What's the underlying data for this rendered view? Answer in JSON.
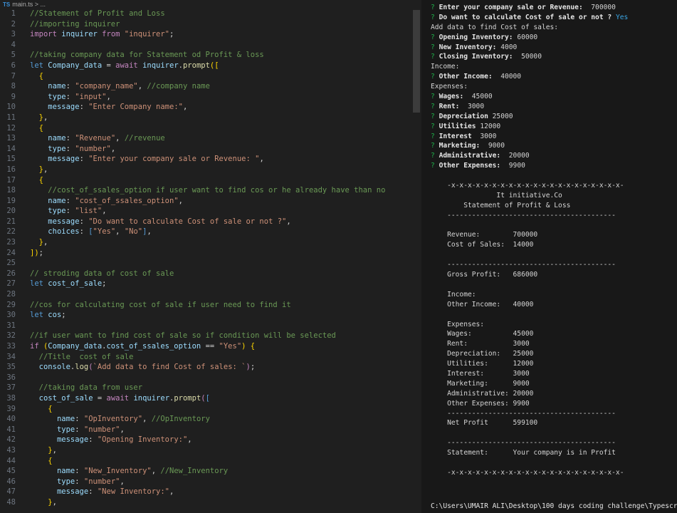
{
  "breadcrumb": {
    "badge": "TS",
    "file": "main.ts",
    "sep": " > ..."
  },
  "code_lines": [
    [
      [
        "c",
        "//Statement of Profit and Loss"
      ]
    ],
    [
      [
        "c",
        "//importing inquirer"
      ]
    ],
    [
      [
        "k",
        "import "
      ],
      [
        "v",
        "inquirer "
      ],
      [
        "k",
        "from "
      ],
      [
        "s",
        "\"inquirer\""
      ],
      [
        "p",
        ";"
      ]
    ],
    [
      [
        "p",
        ""
      ]
    ],
    [
      [
        "c",
        "//taking company data for Statement od Profit & loss"
      ]
    ],
    [
      [
        "b",
        "let "
      ],
      [
        "v",
        "Company_data "
      ],
      [
        "p",
        "= "
      ],
      [
        "k",
        "await "
      ],
      [
        "v",
        "inquirer"
      ],
      [
        "p",
        "."
      ],
      [
        "f",
        "prompt"
      ],
      [
        "y",
        "(["
      ]
    ],
    [
      [
        "p",
        "  "
      ],
      [
        "y",
        "{"
      ]
    ],
    [
      [
        "p",
        "    "
      ],
      [
        "v",
        "name"
      ],
      [
        "p",
        ": "
      ],
      [
        "s",
        "\"company_name\""
      ],
      [
        "p",
        ", "
      ],
      [
        "c",
        "//company name"
      ]
    ],
    [
      [
        "p",
        "    "
      ],
      [
        "v",
        "type"
      ],
      [
        "p",
        ": "
      ],
      [
        "s",
        "\"input\""
      ],
      [
        "p",
        ","
      ]
    ],
    [
      [
        "p",
        "    "
      ],
      [
        "v",
        "message"
      ],
      [
        "p",
        ": "
      ],
      [
        "s",
        "\"Enter Company name:\""
      ],
      [
        "p",
        ","
      ]
    ],
    [
      [
        "p",
        "  "
      ],
      [
        "y",
        "}"
      ],
      [
        "p",
        ","
      ]
    ],
    [
      [
        "p",
        "  "
      ],
      [
        "y",
        "{"
      ]
    ],
    [
      [
        "p",
        "    "
      ],
      [
        "v",
        "name"
      ],
      [
        "p",
        ": "
      ],
      [
        "s",
        "\"Revenue\""
      ],
      [
        "p",
        ", "
      ],
      [
        "c",
        "//revenue"
      ]
    ],
    [
      [
        "p",
        "    "
      ],
      [
        "v",
        "type"
      ],
      [
        "p",
        ": "
      ],
      [
        "s",
        "\"number\""
      ],
      [
        "p",
        ","
      ]
    ],
    [
      [
        "p",
        "    "
      ],
      [
        "v",
        "message"
      ],
      [
        "p",
        ": "
      ],
      [
        "s",
        "\"Enter your company sale or Revenue: \""
      ],
      [
        "p",
        ","
      ]
    ],
    [
      [
        "p",
        "  "
      ],
      [
        "y",
        "}"
      ],
      [
        "p",
        ","
      ]
    ],
    [
      [
        "p",
        "  "
      ],
      [
        "y",
        "{"
      ]
    ],
    [
      [
        "p",
        "    "
      ],
      [
        "c",
        "//cost_of_ssales_option if user want to find cos or he already have than no"
      ]
    ],
    [
      [
        "p",
        "    "
      ],
      [
        "v",
        "name"
      ],
      [
        "p",
        ": "
      ],
      [
        "s",
        "\"cost_of_ssales_option\""
      ],
      [
        "p",
        ","
      ]
    ],
    [
      [
        "p",
        "    "
      ],
      [
        "v",
        "type"
      ],
      [
        "p",
        ": "
      ],
      [
        "s",
        "\"list\""
      ],
      [
        "p",
        ","
      ]
    ],
    [
      [
        "p",
        "    "
      ],
      [
        "v",
        "message"
      ],
      [
        "p",
        ": "
      ],
      [
        "s",
        "\"Do want to calculate Cost of sale or not ?\""
      ],
      [
        "p",
        ","
      ]
    ],
    [
      [
        "p",
        "    "
      ],
      [
        "v",
        "choices"
      ],
      [
        "p",
        ": "
      ],
      [
        "b",
        "["
      ],
      [
        "s",
        "\"Yes\""
      ],
      [
        "p",
        ", "
      ],
      [
        "s",
        "\"No\""
      ],
      [
        "b",
        "]"
      ],
      [
        "p",
        ","
      ]
    ],
    [
      [
        "p",
        "  "
      ],
      [
        "y",
        "}"
      ],
      [
        "p",
        ","
      ]
    ],
    [
      [
        "y",
        "])"
      ],
      [
        "p",
        ";"
      ]
    ],
    [
      [
        "p",
        ""
      ]
    ],
    [
      [
        "c",
        "// stroding data of cost of sale"
      ]
    ],
    [
      [
        "b",
        "let "
      ],
      [
        "v",
        "cost_of_sale"
      ],
      [
        "p",
        ";"
      ]
    ],
    [
      [
        "p",
        ""
      ]
    ],
    [
      [
        "c",
        "//cos for calculating cost of sale if user need to find it"
      ]
    ],
    [
      [
        "b",
        "let "
      ],
      [
        "v",
        "cos"
      ],
      [
        "p",
        ";"
      ]
    ],
    [
      [
        "p",
        ""
      ]
    ],
    [
      [
        "c",
        "//if user want to find cost of sale so if condition will be selected"
      ]
    ],
    [
      [
        "k",
        "if "
      ],
      [
        "y",
        "("
      ],
      [
        "v",
        "Company_data"
      ],
      [
        "p",
        "."
      ],
      [
        "v",
        "cost_of_ssales_option "
      ],
      [
        "p",
        "== "
      ],
      [
        "s",
        "\"Yes\""
      ],
      [
        "y",
        ") "
      ],
      [
        "y",
        "{"
      ]
    ],
    [
      [
        "p",
        "  "
      ],
      [
        "c",
        "//Title  cost of sale"
      ]
    ],
    [
      [
        "p",
        "  "
      ],
      [
        "v",
        "console"
      ],
      [
        "p",
        "."
      ],
      [
        "f",
        "log"
      ],
      [
        "k",
        "("
      ],
      [
        "s",
        "`Add data to find Cost of sales: `"
      ],
      [
        "k",
        ")"
      ],
      [
        "p",
        ";"
      ]
    ],
    [
      [
        "p",
        ""
      ]
    ],
    [
      [
        "p",
        "  "
      ],
      [
        "c",
        "//taking data from user"
      ]
    ],
    [
      [
        "p",
        "  "
      ],
      [
        "v",
        "cost_of_sale "
      ],
      [
        "p",
        "= "
      ],
      [
        "k",
        "await "
      ],
      [
        "v",
        "inquirer"
      ],
      [
        "p",
        "."
      ],
      [
        "f",
        "prompt"
      ],
      [
        "k",
        "("
      ],
      [
        "b",
        "["
      ]
    ],
    [
      [
        "p",
        "    "
      ],
      [
        "y",
        "{"
      ]
    ],
    [
      [
        "p",
        "      "
      ],
      [
        "v",
        "name"
      ],
      [
        "p",
        ": "
      ],
      [
        "s",
        "\"OpInventory\""
      ],
      [
        "p",
        ", "
      ],
      [
        "c",
        "//OpInventory"
      ]
    ],
    [
      [
        "p",
        "      "
      ],
      [
        "v",
        "type"
      ],
      [
        "p",
        ": "
      ],
      [
        "s",
        "\"number\""
      ],
      [
        "p",
        ","
      ]
    ],
    [
      [
        "p",
        "      "
      ],
      [
        "v",
        "message"
      ],
      [
        "p",
        ": "
      ],
      [
        "s",
        "\"Opening Inventory:\""
      ],
      [
        "p",
        ","
      ]
    ],
    [
      [
        "p",
        "    "
      ],
      [
        "y",
        "}"
      ],
      [
        "p",
        ","
      ]
    ],
    [
      [
        "p",
        "    "
      ],
      [
        "y",
        "{"
      ]
    ],
    [
      [
        "p",
        "      "
      ],
      [
        "v",
        "name"
      ],
      [
        "p",
        ": "
      ],
      [
        "s",
        "\"New_Inventory\""
      ],
      [
        "p",
        ", "
      ],
      [
        "c",
        "//New_Inventory"
      ]
    ],
    [
      [
        "p",
        "      "
      ],
      [
        "v",
        "type"
      ],
      [
        "p",
        ": "
      ],
      [
        "s",
        "\"number\""
      ],
      [
        "p",
        ","
      ]
    ],
    [
      [
        "p",
        "      "
      ],
      [
        "v",
        "message"
      ],
      [
        "p",
        ": "
      ],
      [
        "s",
        "\"New Inventory:\""
      ],
      [
        "p",
        ","
      ]
    ],
    [
      [
        "p",
        "    "
      ],
      [
        "y",
        "}"
      ],
      [
        "p",
        ","
      ]
    ]
  ],
  "terminal_lines": [
    [
      [
        "q",
        "? "
      ],
      [
        "bd",
        "Enter your company sale or Revenue:  "
      ],
      [
        "p",
        "700000"
      ]
    ],
    [
      [
        "q",
        "? "
      ],
      [
        "bd",
        "Do want to calculate Cost of sale or not ? "
      ],
      [
        "ans",
        "Yes"
      ]
    ],
    [
      [
        "p",
        "Add data to find Cost of sales:"
      ]
    ],
    [
      [
        "q",
        "? "
      ],
      [
        "bd",
        "Opening Inventory: "
      ],
      [
        "p",
        "60000"
      ]
    ],
    [
      [
        "q",
        "? "
      ],
      [
        "bd",
        "New Inventory: "
      ],
      [
        "p",
        "4000"
      ]
    ],
    [
      [
        "q",
        "? "
      ],
      [
        "bd",
        "Closing Inventory:  "
      ],
      [
        "p",
        "50000"
      ]
    ],
    [
      [
        "p",
        "Income:"
      ]
    ],
    [
      [
        "q",
        "? "
      ],
      [
        "bd",
        "Other Income:  "
      ],
      [
        "p",
        "40000"
      ]
    ],
    [
      [
        "p",
        "Expenses:"
      ]
    ],
    [
      [
        "q",
        "? "
      ],
      [
        "bd",
        "Wages:  "
      ],
      [
        "p",
        "45000"
      ]
    ],
    [
      [
        "q",
        "? "
      ],
      [
        "bd",
        "Rent:  "
      ],
      [
        "p",
        "3000"
      ]
    ],
    [
      [
        "q",
        "? "
      ],
      [
        "bd",
        "Depreciation "
      ],
      [
        "p",
        "25000"
      ]
    ],
    [
      [
        "q",
        "? "
      ],
      [
        "bd",
        "Utilities "
      ],
      [
        "p",
        "12000"
      ]
    ],
    [
      [
        "q",
        "? "
      ],
      [
        "bd",
        "Interest  "
      ],
      [
        "p",
        "3000"
      ]
    ],
    [
      [
        "q",
        "? "
      ],
      [
        "bd",
        "Marketing:  "
      ],
      [
        "p",
        "9000"
      ]
    ],
    [
      [
        "q",
        "? "
      ],
      [
        "bd",
        "Administrative:  "
      ],
      [
        "p",
        "20000"
      ]
    ],
    [
      [
        "q",
        "? "
      ],
      [
        "bd",
        "Other Expenses:  "
      ],
      [
        "p",
        "9900"
      ]
    ],
    [
      [
        "p",
        ""
      ]
    ],
    [
      [
        "p",
        "    -x-x-x-x-x-x-x-x-x-x-x-x-x-x-x-x-x-x-x-x-x-"
      ]
    ],
    [
      [
        "p",
        "                It initiative.Co"
      ]
    ],
    [
      [
        "p",
        "        Statement of Profit & Loss"
      ]
    ],
    [
      [
        "p",
        "    -----------------------------------------"
      ]
    ],
    [
      [
        "p",
        ""
      ]
    ],
    [
      [
        "p",
        "    Revenue:        700000"
      ]
    ],
    [
      [
        "p",
        "    Cost of Sales:  14000"
      ]
    ],
    [
      [
        "p",
        ""
      ]
    ],
    [
      [
        "p",
        "    -----------------------------------------"
      ]
    ],
    [
      [
        "p",
        "    Gross Profit:   686000"
      ]
    ],
    [
      [
        "p",
        ""
      ]
    ],
    [
      [
        "p",
        "    Income:"
      ]
    ],
    [
      [
        "p",
        "    Other Income:   40000"
      ]
    ],
    [
      [
        "p",
        ""
      ]
    ],
    [
      [
        "p",
        "    Expenses:"
      ]
    ],
    [
      [
        "p",
        "    Wages:          45000"
      ]
    ],
    [
      [
        "p",
        "    Rent:           3000"
      ]
    ],
    [
      [
        "p",
        "    Depreciation:   25000"
      ]
    ],
    [
      [
        "p",
        "    Utilities:      12000"
      ]
    ],
    [
      [
        "p",
        "    Interest:       3000"
      ]
    ],
    [
      [
        "p",
        "    Marketing:      9000"
      ]
    ],
    [
      [
        "p",
        "    Administrative: 20000"
      ]
    ],
    [
      [
        "p",
        "    Other Expenses: 9900"
      ]
    ],
    [
      [
        "p",
        "    -----------------------------------------"
      ]
    ],
    [
      [
        "p",
        "    Net Profit      599100"
      ]
    ],
    [
      [
        "p",
        ""
      ]
    ],
    [
      [
        "p",
        "    -----------------------------------------"
      ]
    ],
    [
      [
        "p",
        "    Statement:      Your company is in Profit"
      ]
    ],
    [
      [
        "p",
        ""
      ]
    ],
    [
      [
        "p",
        "    -x-x-x-x-x-x-x-x-x-x-x-x-x-x-x-x-x-x-x-x-x-"
      ]
    ]
  ],
  "shell_prompt": "C:\\Users\\UMAIR ALI\\Desktop\\100 days coding challenge\\Typescript"
}
